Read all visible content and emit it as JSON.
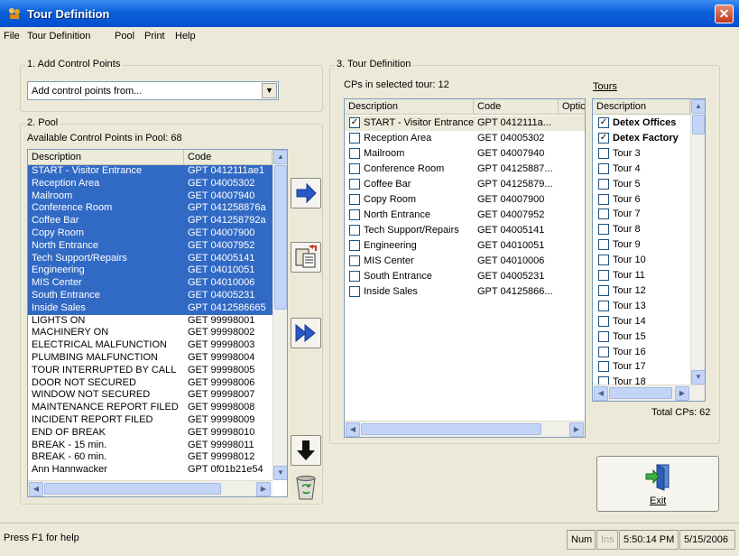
{
  "window": {
    "title": "Tour Definition",
    "close_glyph": "✕"
  },
  "menu": {
    "items": [
      "File",
      "Tour Definition",
      "Pool",
      "Print",
      "Help"
    ]
  },
  "add_control_points": {
    "group_title": "1. Add Control Points",
    "combo_value": "Add control points from..."
  },
  "pool": {
    "group_title": "2. Pool",
    "count_label": "Available Control Points in Pool: 68",
    "columns": [
      "Description",
      "Code"
    ],
    "rows": [
      {
        "d": "START - Visitor Entrance",
        "c": "GPT 0412111ae1",
        "sel": true
      },
      {
        "d": "Reception Area",
        "c": "GET 04005302",
        "sel": true
      },
      {
        "d": "Mailroom",
        "c": "GET 04007940",
        "sel": true
      },
      {
        "d": "Conference Room",
        "c": "GPT 041258876a",
        "sel": true
      },
      {
        "d": "Coffee Bar",
        "c": "GPT 041258792a",
        "sel": true
      },
      {
        "d": "Copy Room",
        "c": "GET 04007900",
        "sel": true
      },
      {
        "d": "North Entrance",
        "c": "GET 04007952",
        "sel": true
      },
      {
        "d": "Tech Support/Repairs",
        "c": "GET 04005141",
        "sel": true
      },
      {
        "d": "Engineering",
        "c": "GET 04010051",
        "sel": true
      },
      {
        "d": "MIS Center",
        "c": "GET 04010006",
        "sel": true
      },
      {
        "d": "South Entrance",
        "c": "GET 04005231",
        "sel": true
      },
      {
        "d": "Inside Sales",
        "c": "GPT 0412586665",
        "sel": true
      },
      {
        "d": "LIGHTS ON",
        "c": "GET 99998001",
        "sel": false
      },
      {
        "d": "MACHINERY ON",
        "c": "GET 99998002",
        "sel": false
      },
      {
        "d": "ELECTRICAL MALFUNCTION",
        "c": "GET 99998003",
        "sel": false
      },
      {
        "d": "PLUMBING MALFUNCTION",
        "c": "GET 99998004",
        "sel": false
      },
      {
        "d": "TOUR INTERRUPTED BY CALL",
        "c": "GET 99998005",
        "sel": false
      },
      {
        "d": "DOOR NOT SECURED",
        "c": "GET 99998006",
        "sel": false
      },
      {
        "d": "WINDOW NOT SECURED",
        "c": "GET 99998007",
        "sel": false
      },
      {
        "d": "MAINTENANCE REPORT FILED",
        "c": "GET 99998008",
        "sel": false
      },
      {
        "d": "INCIDENT REPORT FILED",
        "c": "GET 99998009",
        "sel": false
      },
      {
        "d": "END OF BREAK",
        "c": "GET 99998010",
        "sel": false
      },
      {
        "d": "BREAK - 15 min.",
        "c": "GET 99998011",
        "sel": false
      },
      {
        "d": "BREAK - 60 min.",
        "c": "GET 99998012",
        "sel": false
      },
      {
        "d": "Ann Hannwacker",
        "c": "GPT 0f01b21e54",
        "sel": false
      }
    ]
  },
  "tour_definition": {
    "group_title": "3. Tour Definition",
    "cps_label": "CPs in selected tour: 12",
    "columns": [
      "Description",
      "Code",
      "Optic"
    ],
    "rows": [
      {
        "d": "START - Visitor Entrance",
        "c": "GPT 0412111a...",
        "checked": true
      },
      {
        "d": "Reception Area",
        "c": "GET 04005302",
        "checked": false
      },
      {
        "d": "Mailroom",
        "c": "GET 04007940",
        "checked": false
      },
      {
        "d": "Conference Room",
        "c": "GPT 04125887...",
        "checked": false
      },
      {
        "d": "Coffee Bar",
        "c": "GPT 04125879...",
        "checked": false
      },
      {
        "d": "Copy Room",
        "c": "GET 04007900",
        "checked": false
      },
      {
        "d": "North Entrance",
        "c": "GET 04007952",
        "checked": false
      },
      {
        "d": "Tech Support/Repairs",
        "c": "GET 04005141",
        "checked": false
      },
      {
        "d": "Engineering",
        "c": "GET 04010051",
        "checked": false
      },
      {
        "d": "MIS Center",
        "c": "GET 04010006",
        "checked": false
      },
      {
        "d": "South Entrance",
        "c": "GET 04005231",
        "checked": false
      },
      {
        "d": "Inside Sales",
        "c": "GPT 04125866...",
        "checked": false
      }
    ]
  },
  "tours": {
    "label": "Tours",
    "column": "Description",
    "rows": [
      {
        "d": "Detex Offices",
        "checked": true,
        "bold": true
      },
      {
        "d": "Detex Factory",
        "checked": true,
        "bold": true
      },
      {
        "d": "Tour 3",
        "checked": false,
        "bold": false
      },
      {
        "d": "Tour 4",
        "checked": false,
        "bold": false
      },
      {
        "d": "Tour 5",
        "checked": false,
        "bold": false
      },
      {
        "d": "Tour 6",
        "checked": false,
        "bold": false
      },
      {
        "d": "Tour 7",
        "checked": false,
        "bold": false
      },
      {
        "d": "Tour 8",
        "checked": false,
        "bold": false
      },
      {
        "d": "Tour 9",
        "checked": false,
        "bold": false
      },
      {
        "d": "Tour 10",
        "checked": false,
        "bold": false
      },
      {
        "d": "Tour 11",
        "checked": false,
        "bold": false
      },
      {
        "d": "Tour 12",
        "checked": false,
        "bold": false
      },
      {
        "d": "Tour 13",
        "checked": false,
        "bold": false
      },
      {
        "d": "Tour 14",
        "checked": false,
        "bold": false
      },
      {
        "d": "Tour 15",
        "checked": false,
        "bold": false
      },
      {
        "d": "Tour 16",
        "checked": false,
        "bold": false
      },
      {
        "d": "Tour 17",
        "checked": false,
        "bold": false
      },
      {
        "d": "Tour 18",
        "checked": false,
        "bold": false
      }
    ],
    "total_label": "Total CPs: 62"
  },
  "buttons": {
    "exit_label": "Exit"
  },
  "status": {
    "help_text": "Press F1 for help",
    "num": "Num",
    "ins": "Ins",
    "time": "5:50:14 PM",
    "date": "5/15/2006"
  },
  "colors": {
    "selection": "#316ac5",
    "arrow_blue": "#2a57c9"
  }
}
